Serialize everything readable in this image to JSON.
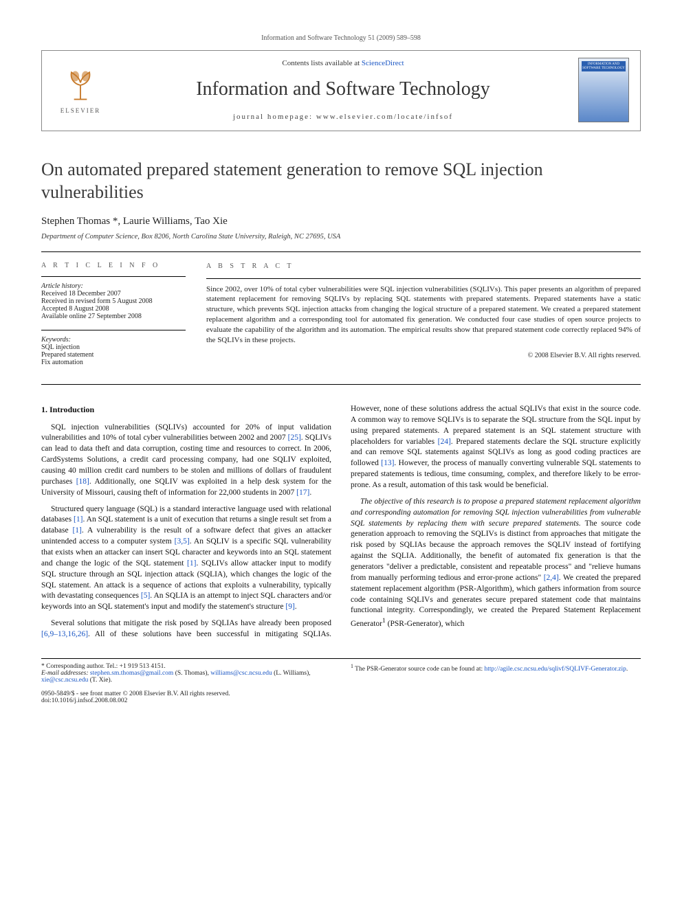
{
  "running_head": "Information and Software Technology 51 (2009) 589–598",
  "header": {
    "contents_prefix": "Contents lists available at ",
    "contents_link": "ScienceDirect",
    "journal_name": "Information and Software Technology",
    "homepage_prefix": "journal homepage: ",
    "homepage_url": "www.elsevier.com/locate/infsof",
    "publisher_word": "ELSEVIER",
    "cover_text": "INFORMATION AND SOFTWARE TECHNOLOGY"
  },
  "title": "On automated prepared statement generation to remove SQL injection vulnerabilities",
  "authors": "Stephen Thomas *, Laurie Williams, Tao Xie",
  "affiliation": "Department of Computer Science, Box 8206, North Carolina State University, Raleigh, NC 27695, USA",
  "article_info": {
    "heading": "A R T I C L E   I N F O",
    "history_label": "Article history:",
    "received": "Received 18 December 2007",
    "revised": "Received in revised form 5 August 2008",
    "accepted": "Accepted 8 August 2008",
    "online": "Available online 27 September 2008",
    "keywords_label": "Keywords:",
    "kw1": "SQL injection",
    "kw2": "Prepared statement",
    "kw3": "Fix automation"
  },
  "abstract": {
    "heading": "A B S T R A C T",
    "text": "Since 2002, over 10% of total cyber vulnerabilities were SQL injection vulnerabilities (SQLIVs). This paper presents an algorithm of prepared statement replacement for removing SQLIVs by replacing SQL statements with prepared statements. Prepared statements have a static structure, which prevents SQL injection attacks from changing the logical structure of a prepared statement. We created a prepared statement replacement algorithm and a corresponding tool for automated fix generation. We conducted four case studies of open source projects to evaluate the capability of the algorithm and its automation. The empirical results show that prepared statement code correctly replaced 94% of the SQLIVs in these projects.",
    "copyright": "© 2008 Elsevier B.V. All rights reserved."
  },
  "body": {
    "section1_heading": "1. Introduction",
    "p1a": "SQL injection vulnerabilities (SQLIVs) accounted for 20% of input validation vulnerabilities and 10% of total cyber vulnerabilities between 2002 and 2007 ",
    "p1_ref1": "[25]",
    "p1b": ". SQLIVs can lead to data theft and data corruption, costing time and resources to correct. In 2006, CardSystems Solutions, a credit card processing company, had one SQLIV exploited, causing 40 million credit card numbers to be stolen and millions of dollars of fraudulent purchases ",
    "p1_ref2": "[18]",
    "p1c": ". Additionally, one SQLIV was exploited in a help desk system for the University of Missouri, causing theft of information for 22,000 students in 2007 ",
    "p1_ref3": "[17]",
    "p1d": ".",
    "p2a": "Structured query language (SQL) is a standard interactive language used with relational databases ",
    "p2_ref1": "[1]",
    "p2b": ". An SQL statement is a unit of execution that returns a single result set from a database ",
    "p2_ref2": "[1]",
    "p2c": ". A vulnerability is the result of a software defect that gives an attacker unintended access to a computer system ",
    "p2_ref3": "[3,5]",
    "p2d": ". An SQLIV is a specific SQL vulnerability that exists when an attacker can insert SQL character and keywords into an SQL statement and change the logic of the SQL statement ",
    "p2_ref4": "[1]",
    "p2e": ". SQLIVs allow attacker input to modify SQL structure through an SQL injection attack (SQLIA), which changes the logic of the SQL statement. An attack is a sequence of actions that exploits a vulnerability, typically with devastating consequences ",
    "p2_ref5": "[5]",
    "p2f": ". An SQLIA is an attempt to inject SQL characters and/or keywords into an SQL statement's input and modify the statement's structure ",
    "p2_ref6": "[9]",
    "p2g": ".",
    "p3a": "Several solutions that mitigate the risk posed by SQLIAs have already been proposed ",
    "p3_ref1": "[6,9–13,16,26]",
    "p3b": ". All of these solutions have been successful in mitigating SQLIAs. However, none of these solutions address the actual SQLIVs that exist in the source code. A common way to remove SQLIVs is to separate the SQL structure from the SQL input by using prepared statements. A prepared statement is an SQL statement structure with placeholders for variables ",
    "p3_ref2": "[24]",
    "p3c": ". Prepared statements declare the SQL structure explicitly and can remove SQL statements against SQLIVs as long as good coding practices are followed ",
    "p3_ref3": "[13]",
    "p3d": ". However, the process of manually converting vulnerable SQL statements to prepared statements is tedious, time consuming, complex, and therefore likely to be error-prone. As a result, automation of this task would be beneficial.",
    "p4a_italic": "The objective of this research is to propose a prepared statement replacement algorithm and corresponding automation for removing SQL injection vulnerabilities from vulnerable SQL statements by replacing them with secure prepared statements.",
    "p4b": " The source code generation approach to removing the SQLIVs is distinct from approaches that mitigate the risk posed by SQLIAs because the approach removes the SQLIV instead of fortifying against the SQLIA. Additionally, the benefit of automated fix generation is that the generators \"deliver a predictable, consistent and repeatable process\" and \"relieve humans from manually performing tedious and error-prone actions\" ",
    "p4_ref1": "[2,4]",
    "p4c": ". We created the prepared statement replacement algorithm (PSR-Algorithm), which gathers information from source code containing SQLIVs and generates secure prepared statement code that maintains functional integrity. Correspondingly, we created the Prepared Statement Replacement Generator",
    "p4_sup": "1",
    "p4d": " (PSR-Generator), which"
  },
  "footnotes": {
    "left1": "* Corresponding author. Tel.: +1 919 513 4151.",
    "left2_label": "E-mail addresses:",
    "left2a": " stephen.sm.thomas@gmail.com",
    "left2a_aff": " (S. Thomas), ",
    "left2b": "williams@csc.ncsu.edu",
    "left2b_aff": " (L. Williams), ",
    "left2c": "xie@csc.ncsu.edu",
    "left2c_aff": " (T. Xie).",
    "right_sup": "1",
    "right_text": " The PSR-Generator source code can be found at: ",
    "right_link": "http://agile.csc.ncsu.edu/sqlivf/SQLIVF-Generator.zip",
    "right_tail": "."
  },
  "doi": {
    "line1": "0950-5849/$ - see front matter © 2008 Elsevier B.V. All rights reserved.",
    "line2": "doi:10.1016/j.infsof.2008.08.002"
  }
}
